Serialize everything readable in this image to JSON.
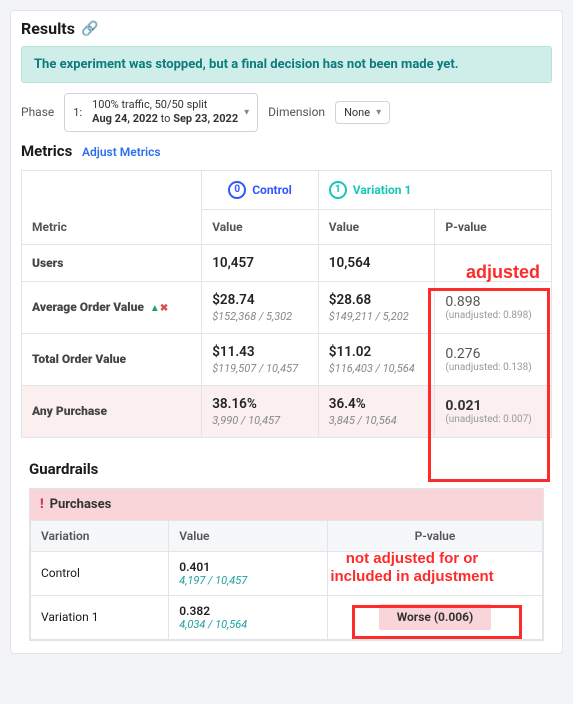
{
  "header": {
    "title": "Results"
  },
  "banner": "The experiment was stopped, but a final decision has not been made yet.",
  "controls": {
    "phase_label": "Phase",
    "phase_select": {
      "num": "1:",
      "line1": "100% traffic, 50/50 split",
      "line2_prefix": "Aug 24, 2022",
      "line2_mid": " to ",
      "line2_suffix": "Sep 23, 2022"
    },
    "dimension_label": "Dimension",
    "dimension_value": "None"
  },
  "metrics_section": {
    "title": "Metrics",
    "adjust_link": "Adjust Metrics"
  },
  "columns": {
    "metric": "Metric",
    "control_group": "Control",
    "variation_group": "Variation 1",
    "control_badge": "0",
    "variation_badge": "1",
    "value": "Value",
    "pvalue": "P-value"
  },
  "rows": [
    {
      "metric": "Users",
      "ctrl_main": "10,457",
      "ctrl_sub": "",
      "var_main": "10,564",
      "var_sub": "",
      "pval_main": "",
      "pval_sub": ""
    },
    {
      "metric": "Average Order Value",
      "has_icons": true,
      "ctrl_main": "$28.74",
      "ctrl_sub": "$152,368 / 5,302",
      "var_main": "$28.68",
      "var_sub": "$149,211 / 5,202",
      "pval_main": "0.898",
      "pval_sub": "(unadjusted: 0.898)"
    },
    {
      "metric": "Total Order Value",
      "ctrl_main": "$11.43",
      "ctrl_sub": "$119,507 / 10,457",
      "var_main": "$11.02",
      "var_sub": "$116,403 / 10,564",
      "pval_main": "0.276",
      "pval_sub": "(unadjusted: 0.138)"
    },
    {
      "metric": "Any Purchase",
      "bad": true,
      "ctrl_main": "38.16%",
      "ctrl_sub": "3,990 / 10,457",
      "var_main": "36.4%",
      "var_sub": "3,845 / 10,564",
      "pval_main": "0.021",
      "pval_sub": "(unadjusted: 0.007)"
    }
  ],
  "guardrails": {
    "title": "Guardrails",
    "header": "Purchases",
    "cols": {
      "variation": "Variation",
      "value": "Value",
      "pvalue": "P-value"
    },
    "rows": [
      {
        "variation": "Control",
        "val_main": "0.401",
        "val_sub": "4,197 / 10,457",
        "pval": ""
      },
      {
        "variation": "Variation 1",
        "val_main": "0.382",
        "val_sub": "4,034 / 10,564",
        "pval": "Worse (0.006)"
      }
    ]
  },
  "annotations": {
    "adjusted": "adjusted",
    "not_adjusted": "not adjusted for or\nincluded in adjustment"
  }
}
